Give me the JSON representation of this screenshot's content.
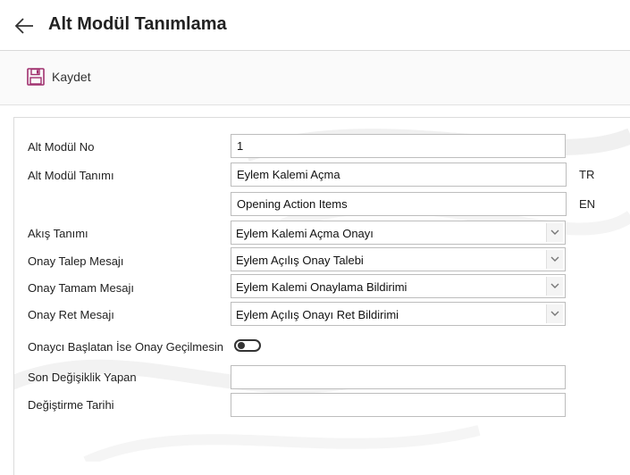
{
  "header": {
    "title": "Alt Modül Tanımlama",
    "back_icon": "arrow-left-icon"
  },
  "toolbar": {
    "save_label": "Kaydet",
    "save_icon": "floppy-disk-icon",
    "save_icon_color": "#a0306e"
  },
  "form": {
    "sub_module_no": {
      "label": "Alt Modül No",
      "value": "1"
    },
    "sub_module_name": {
      "label": "Alt Modül Tanımı",
      "tr_value": "Eylem Kalemi Açma",
      "tr_tag": "TR",
      "en_value": "Opening Action Items",
      "en_tag": "EN"
    },
    "flow": {
      "label": "Akış Tanımı",
      "value": "Eylem Kalemi Açma Onayı"
    },
    "approval_request": {
      "label": "Onay Talep Mesajı",
      "value": "Eylem Açılış Onay Talebi"
    },
    "approval_complete": {
      "label": "Onay Tamam Mesajı",
      "value": "Eylem Kalemi Onaylama Bildirimi"
    },
    "approval_reject": {
      "label": "Onay Ret Mesajı",
      "value": "Eylem Açılış Onayı Ret Bildirimi"
    },
    "skip_approval": {
      "label": "Onaycı Başlatan İse Onay Geçilmesin",
      "checked": false
    },
    "last_modified_by": {
      "label": "Son Değişiklik Yapan",
      "value": ""
    },
    "modified_date": {
      "label": "Değiştirme Tarihi",
      "value": ""
    }
  }
}
